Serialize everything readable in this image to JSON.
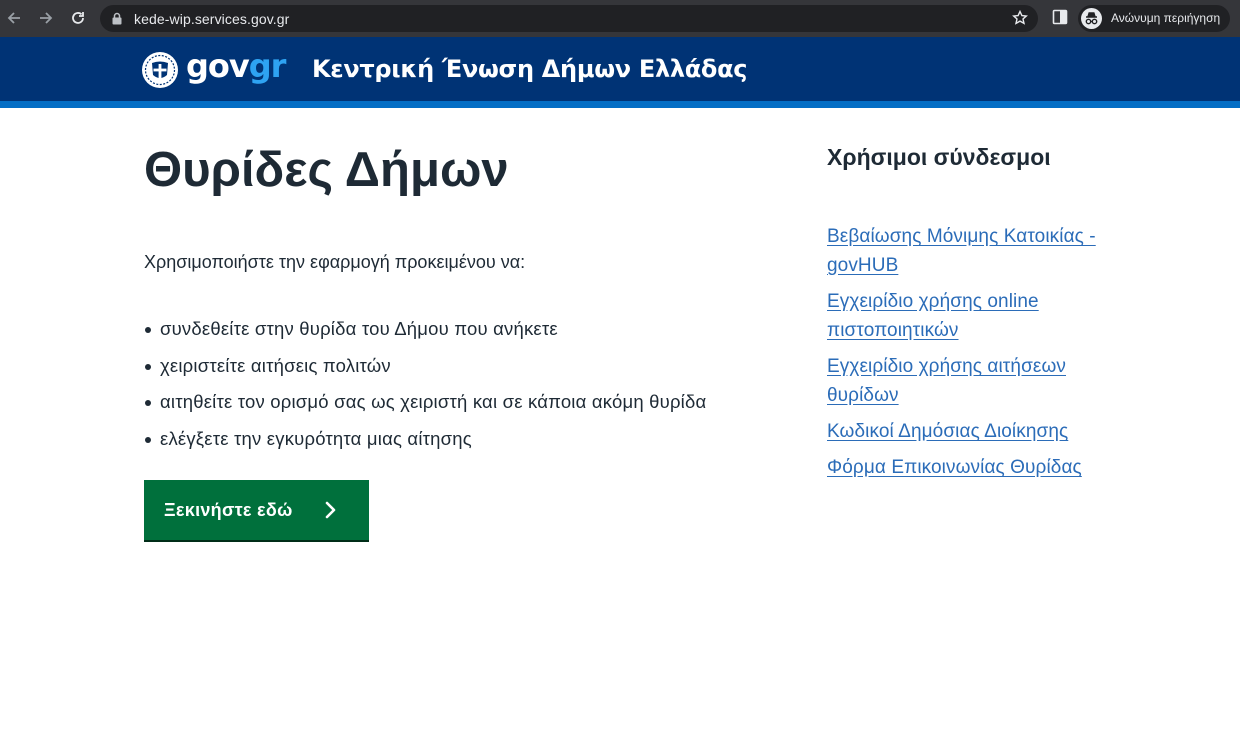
{
  "browser": {
    "url": "kede-wip.services.gov.gr",
    "incognito_label": "Ανώνυμη περιήγηση",
    "icons": [
      "back-icon",
      "forward-icon",
      "reload-icon",
      "lock-icon",
      "star-icon",
      "side-panel-icon",
      "incognito-icon"
    ]
  },
  "header": {
    "logo_gov": "gov",
    "logo_gr": "gr",
    "site_title": "Κεντρική Ένωση Δήμων Ελλάδας",
    "colors": {
      "bar": "#003375",
      "stripe": "#046ec5",
      "logo_gr": "#2ea3f2"
    }
  },
  "main": {
    "title": "Θυρίδες Δήμων",
    "intro": "Χρησιμοποιήστε την εφαρμογή προκειμένου να:",
    "bullets": [
      "συνδεθείτε στην θυρίδα του Δήμου που ανήκετε",
      "χειριστείτε αιτήσεις πολιτών",
      "αιτηθείτε τον ορισμό σας ως χειριστή και σε κάποια ακόμη θυρίδα",
      "ελέγξετε την εγκυρότητα μιας αίτησης"
    ],
    "start_button": "Ξεκινήστε εδώ",
    "start_button_color": "#00703c"
  },
  "sidebar": {
    "title": "Χρήσιμοι σύνδεσμοι",
    "links": [
      "Βεβαίωσης Μόνιμης Κατοικίας - govHUB",
      "Εγχειρίδιο χρήσης online πιστοποιητικών",
      "Εγχειρίδιο χρήσης αιτήσεων θυρίδων",
      "Κωδικοί Δημόσιας Διοίκησης",
      "Φόρμα Επικοινωνίας Θυρίδας"
    ],
    "link_color": "#2b6cb8"
  }
}
